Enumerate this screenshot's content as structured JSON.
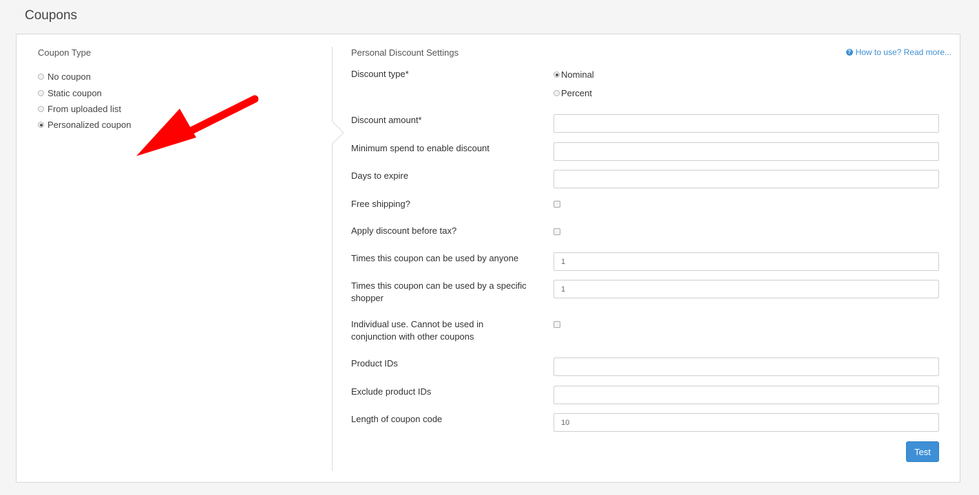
{
  "page": {
    "title": "Coupons"
  },
  "coupon_type": {
    "title": "Coupon Type",
    "options": [
      {
        "label": "No coupon",
        "checked": false
      },
      {
        "label": "Static coupon",
        "checked": false
      },
      {
        "label": "From uploaded list",
        "checked": false
      },
      {
        "label": "Personalized coupon",
        "checked": true
      }
    ]
  },
  "settings": {
    "title": "Personal Discount Settings",
    "help_link": "How to use? Read more...",
    "discount_type": {
      "label": "Discount type*",
      "options": [
        {
          "label": "Nominal",
          "checked": true
        },
        {
          "label": "Percent",
          "checked": false
        }
      ]
    },
    "discount_amount": {
      "label": "Discount amount*",
      "value": ""
    },
    "minimum_spend": {
      "label": "Minimum spend to enable discount",
      "value": ""
    },
    "days_to_expire": {
      "label": "Days to expire",
      "value": ""
    },
    "free_shipping": {
      "label": "Free shipping?",
      "checked": false
    },
    "before_tax": {
      "label": "Apply discount before tax?",
      "checked": false
    },
    "usage_anyone": {
      "label": "Times this coupon can be used by anyone",
      "value": "1"
    },
    "usage_shopper": {
      "label": "Times this coupon can be used by a specific shopper",
      "value": "1"
    },
    "individual_use": {
      "label": "Individual use. Cannot be used in conjunction with other coupons",
      "checked": false
    },
    "product_ids": {
      "label": "Product IDs",
      "value": ""
    },
    "exclude_product_ids": {
      "label": "Exclude product IDs",
      "value": ""
    },
    "code_length": {
      "label": "Length of coupon code",
      "value": "10"
    },
    "test_button": "Test"
  },
  "colors": {
    "accent": "#3e8fd6",
    "arrow": "#ff0000"
  }
}
